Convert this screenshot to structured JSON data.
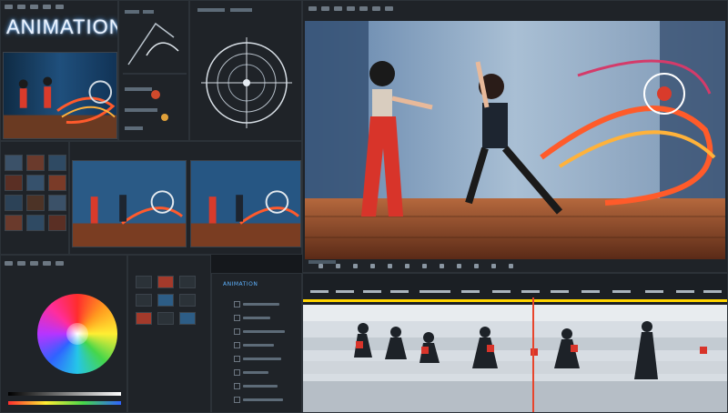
{
  "app": {
    "title": "ANIMATION"
  },
  "colors": {
    "accent": "#4aa3ff",
    "playhead": "#e8452c",
    "timeline_strip": "#ffd400"
  },
  "timeline": {
    "tracks_label": "ANIMATION",
    "playhead_fraction": 0.54
  },
  "icons": [
    "radial-tool-icon",
    "curve-tool-icon",
    "color-wheel-icon",
    "eye-icon",
    "lock-icon",
    "play-icon"
  ]
}
